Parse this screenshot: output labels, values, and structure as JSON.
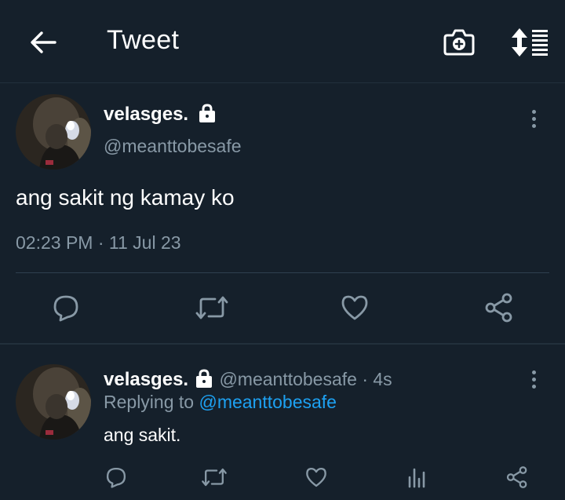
{
  "header": {
    "title": "Tweet"
  },
  "tweet": {
    "display_name": "velasges.",
    "handle": "@meanttobesafe",
    "text": "ang sakit ng kamay ko",
    "time": "02:23 PM",
    "separator": " · ",
    "date": "11 Jul 23"
  },
  "reply": {
    "display_name": "velasges.",
    "handle": "@meanttobesafe",
    "age": " · 4s",
    "replying_prefix": "Replying to ",
    "replying_to": "@meanttobesafe",
    "text": "ang sakit."
  },
  "colors": {
    "background": "#15202b",
    "muted": "#8899a6",
    "link": "#1da1f2"
  }
}
